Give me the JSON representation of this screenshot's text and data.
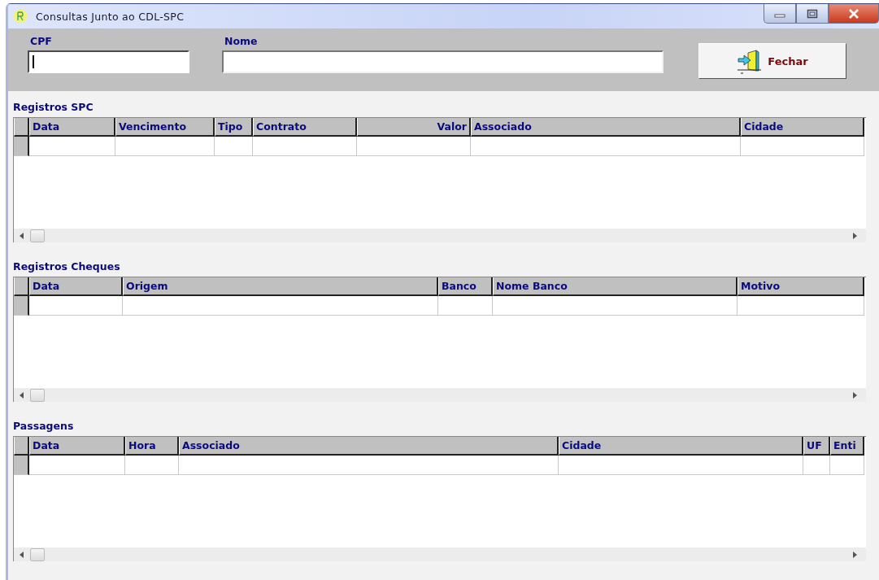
{
  "window": {
    "title": "Consultas Junto ao CDL-SPC"
  },
  "filters": [
    {
      "label": "CPF",
      "focused": true
    },
    {
      "label": "Nome",
      "focused": false
    }
  ],
  "close_button": {
    "label": "Fechar"
  },
  "grids": [
    {
      "title": "Registros SPC",
      "columns": [
        "Data",
        "Vencimento",
        "Tipo",
        "Contrato",
        "Valor",
        "Associado",
        "Cidade"
      ]
    },
    {
      "title": "Registros Cheques",
      "columns": [
        "Data",
        "Origem",
        "Banco",
        "Nome Banco",
        "Motivo"
      ]
    },
    {
      "title": "Passagens",
      "columns": [
        "Data",
        "Hora",
        "Associado",
        "Cidade",
        "UF",
        "Enti"
      ]
    }
  ]
}
